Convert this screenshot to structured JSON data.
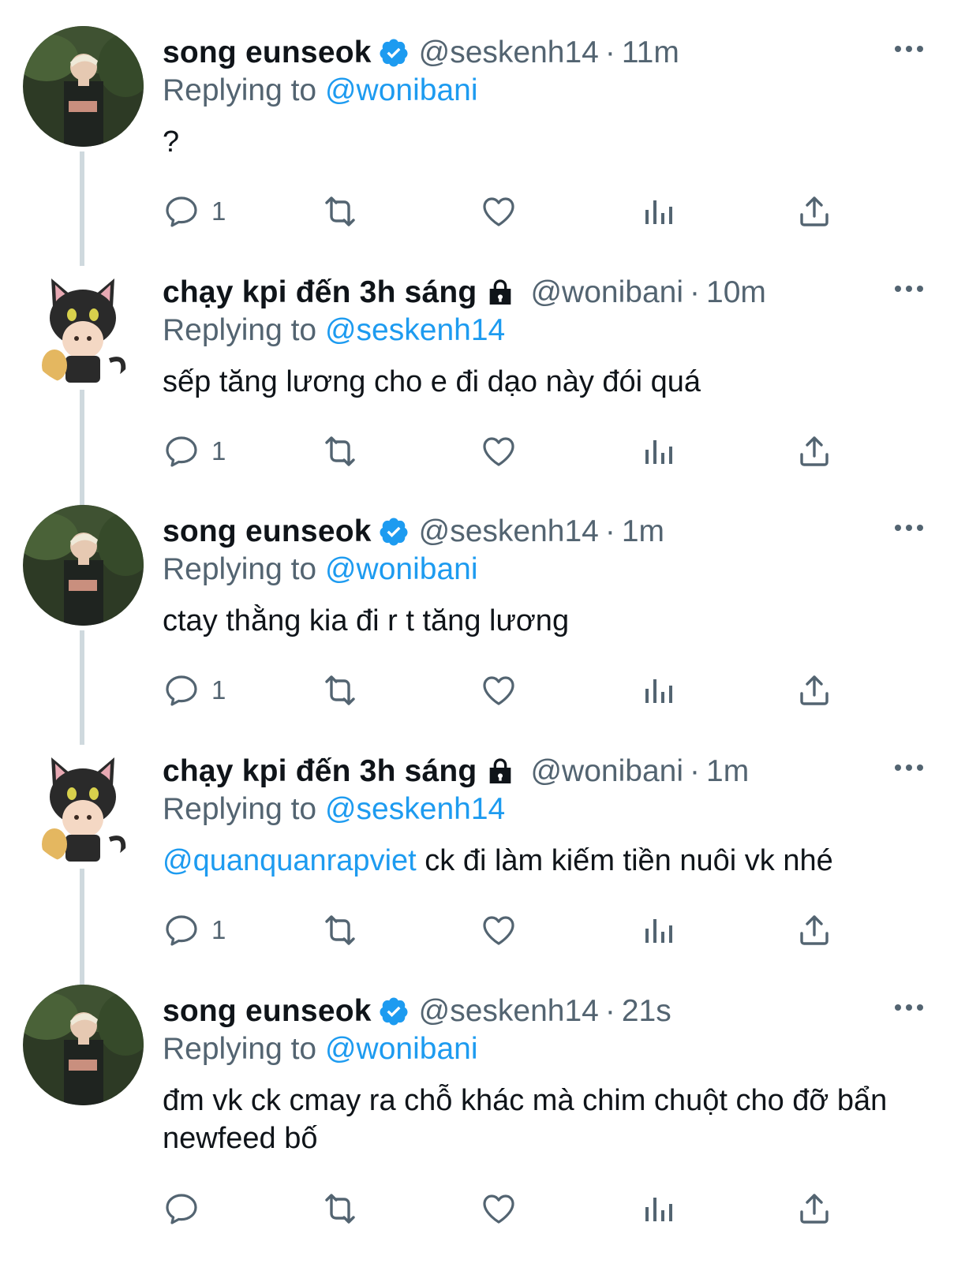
{
  "replying_to_label": "Replying to",
  "tweets": [
    {
      "name": "song eunseok",
      "handle": "@seskenh14",
      "time": "11m",
      "verified": true,
      "protected": false,
      "replying_to": "@wonibani",
      "mention": "",
      "text": "?",
      "reply_count": "1"
    },
    {
      "name": "chạy kpi đến 3h sáng",
      "handle": "@wonibani",
      "time": "10m",
      "verified": false,
      "protected": true,
      "replying_to": "@seskenh14",
      "mention": "",
      "text": "sếp tăng lương cho e đi dạo này đói quá",
      "reply_count": "1"
    },
    {
      "name": "song eunseok",
      "handle": "@seskenh14",
      "time": "1m",
      "verified": true,
      "protected": false,
      "replying_to": "@wonibani",
      "mention": "",
      "text": "ctay thằng kia đi r t tăng lương",
      "reply_count": "1"
    },
    {
      "name": "chạy kpi đến 3h sáng",
      "handle": "@wonibani",
      "time": "1m",
      "verified": false,
      "protected": true,
      "replying_to": "@seskenh14",
      "mention": "@quanquanrapviet",
      "text": " ck đi làm kiếm tiền nuôi vk nhé",
      "reply_count": "1"
    },
    {
      "name": "song eunseok",
      "handle": "@seskenh14",
      "time": "21s",
      "verified": true,
      "protected": false,
      "replying_to": "@wonibani",
      "mention": "",
      "text": "đm vk ck cmay ra chỗ khác mà chim chuột cho đỡ bẩn newfeed bố",
      "reply_count": ""
    }
  ],
  "colors": {
    "text": "#0f1419",
    "secondary": "#536471",
    "link": "#1d9bf0",
    "thread_line": "#cfd9de"
  },
  "icons": [
    "verified-badge-icon",
    "lock-icon",
    "more-icon",
    "reply-icon",
    "retweet-icon",
    "like-icon",
    "analytics-icon",
    "share-icon"
  ]
}
